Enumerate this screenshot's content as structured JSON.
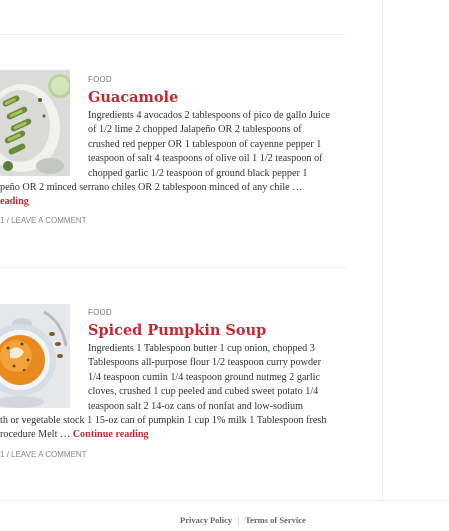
{
  "posts": [
    {
      "category": "FOOD",
      "title": "Guacamole",
      "excerpt_lines": [
        "Ingredients 4 avocados 2 tablespoons of pico de gallo Juice",
        "of 1/2 lime 2 chopped Jalapeño OR 2 tablespoons of",
        "crushed red pepper OR 1 tablespoon of cayenne pepper 1",
        "teaspoon of salt 4 teaspoons of olive oil 1 1/2 teaspoon of",
        "chopped garlic 1/2 teaspoon of ground black pepper 1",
        "peño OR 2 minced serrano chiles OR 2 tablespoon minced of any chile …"
      ],
      "read_more": "eading",
      "meta_date": "1",
      "meta_comment": "LEAVE A COMMENT"
    },
    {
      "category": "FOOD",
      "title": "Spiced Pumpkin Soup",
      "excerpt_lines": [
        "Ingredients 1 Tablespoon butter 1 cup onion, chopped 3",
        "Tablespoons all-purpose flour 1/2 teaspoon curry powder",
        "1/4 teaspoon cumin 1/4 teaspoon ground nutmeg 2 garlic",
        "cloves, crushed 1 cup peeled and cubed sweet potato 1/4",
        "teaspoon salt 2 14-oz cans of nonfat and low-sodium",
        "th or vegetable stock 1 15-oz can of pumpkin 1 cup 1% milk 1 Tablespoon fresh",
        "rocedure Melt …"
      ],
      "read_more": "Continue reading",
      "meta_date": "1",
      "meta_comment": "LEAVE A COMMENT"
    }
  ],
  "footer": {
    "privacy": "Privacy Policy",
    "terms": "Terms of Service"
  },
  "colors": {
    "accent": "#c12b33",
    "text": "#333333",
    "meta": "#888888"
  }
}
